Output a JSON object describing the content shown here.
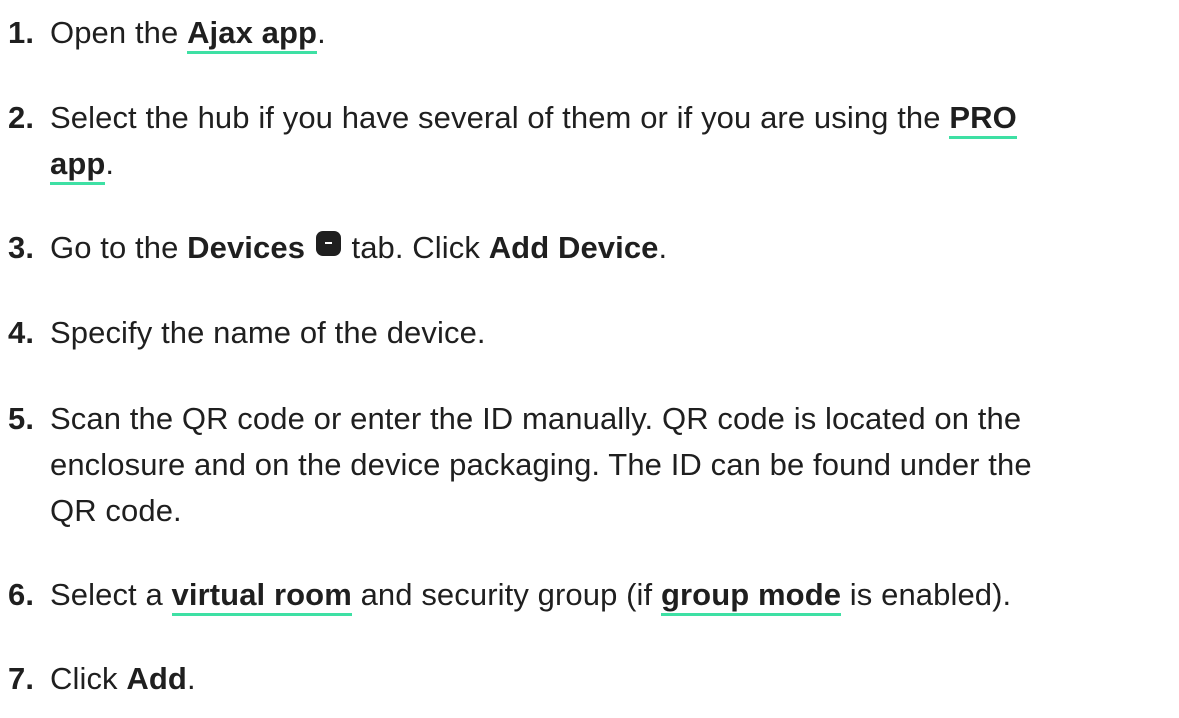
{
  "steps": [
    {
      "num": "1.",
      "pre": "Open the ",
      "link": "Ajax app",
      "post": "."
    },
    {
      "num": "2.",
      "pre": "Select the hub if you have several of them or if you are using the ",
      "link_part1": "PRO",
      "link_part2": "app",
      "post": "."
    },
    {
      "num": "3.",
      "pre": "Go to the ",
      "bold1": "Devices",
      "icon": "devices-tab-icon",
      "mid": " tab. Click ",
      "bold2": "Add Device",
      "post": "."
    },
    {
      "num": "4.",
      "text": "Specify the name of the device."
    },
    {
      "num": "5.",
      "line1": "Scan the QR code or enter the ID manually. QR code is located on the",
      "line2": "enclosure and on the device packaging. The ID can be found under the",
      "line3": "QR code."
    },
    {
      "num": "6.",
      "pre": "Select a ",
      "link1": "virtual room",
      "mid": " and security group (if ",
      "link2": "group mode",
      "post": " is enabled)."
    },
    {
      "num": "7.",
      "pre": "Click ",
      "bold": "Add",
      "post": "."
    }
  ],
  "colors": {
    "text": "#1f1f1f",
    "link_underline": "#3ee0a4"
  }
}
